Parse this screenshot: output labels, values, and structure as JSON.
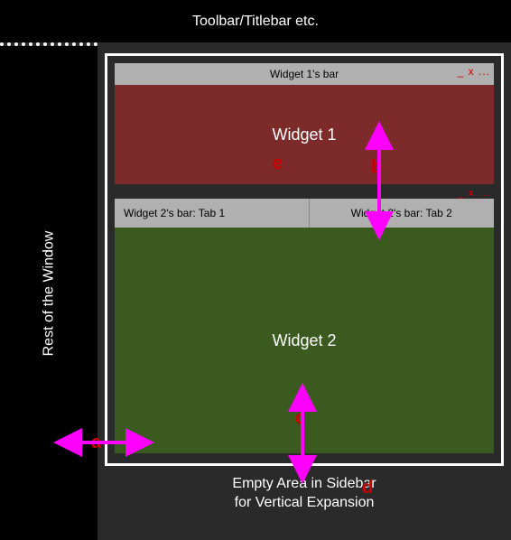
{
  "titlebar": {
    "label": "Toolbar/Titlebar etc."
  },
  "leftcol": {
    "label": "Rest of the Window"
  },
  "widget1": {
    "bar_label": "Widget 1's bar",
    "body_label": "Widget 1",
    "controls": "_ x ..."
  },
  "widget2": {
    "tab1_label": "Widget 2's bar: Tab 1",
    "tab2_label": "Widget 2's bar: Tab 2",
    "body_label": "Widget 2",
    "controls": "_ x ..."
  },
  "empty_area": {
    "line1": "Empty Area in Sidebar",
    "line2": "for Vertical Expansion"
  },
  "annotations": {
    "a": "a",
    "b": "b",
    "c": "c",
    "d": "d",
    "e": "e"
  },
  "colors": {
    "arrow": "#ff00ff",
    "ann": "#cc0000",
    "widget1_body": "#7d2a2a",
    "widget2_body": "#3a5a1f",
    "bar": "#b0b0b0"
  }
}
